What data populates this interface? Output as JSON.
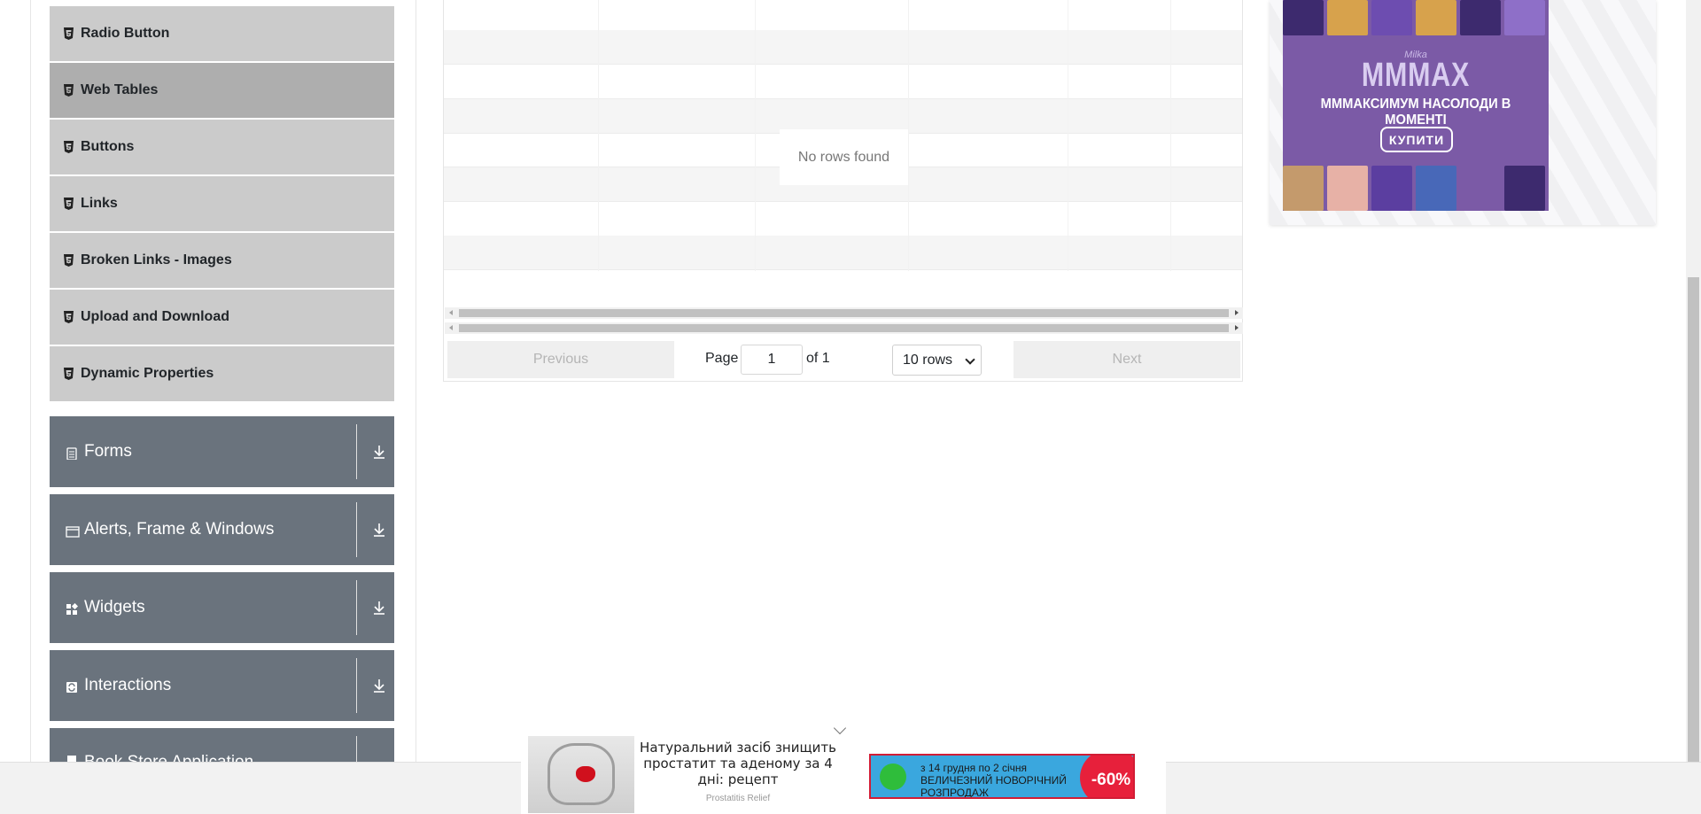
{
  "sidebar": {
    "items": [
      {
        "label": "Radio Button"
      },
      {
        "label": "Web Tables",
        "active": true
      },
      {
        "label": "Buttons"
      },
      {
        "label": "Links"
      },
      {
        "label": "Broken Links - Images"
      },
      {
        "label": "Upload and Download"
      },
      {
        "label": "Dynamic Properties"
      }
    ],
    "groups": [
      {
        "label": "Forms",
        "icon": "clipboard-icon"
      },
      {
        "label": "Alerts, Frame & Windows",
        "icon": "window-icon"
      },
      {
        "label": "Widgets",
        "icon": "widgets-icon"
      },
      {
        "label": "Interactions",
        "icon": "interactions-icon"
      },
      {
        "label": "Book Store Application",
        "icon": "book-icon"
      }
    ]
  },
  "table": {
    "empty_message": "No rows found"
  },
  "pagination": {
    "previous_label": "Previous",
    "page_label": "Page",
    "page_value": "1",
    "of_label": "of 1",
    "rows_selected": "10 rows",
    "next_label": "Next"
  },
  "ad_right": {
    "brand": "Milka",
    "headline": "МММАХ",
    "tagline": "МММАКСИМУМ НАСОЛОДИ В МОМЕНТІ",
    "button": "КУПИТИ",
    "colors": {
      "background": "#7b5aa6"
    }
  },
  "ad_bottom": {
    "text": "Натуральний засіб знищить простатит та аденому за 4 дні: рецепт",
    "source": "Prostatitis Relief",
    "sale_line1": "з 14 грудня по 2 січня",
    "sale_line2": "ВЕЛИЧЕЗНИЙ НОВОРІЧНИЙ",
    "sale_line3": "РОЗПРОДАЖ",
    "discount": "-60%"
  },
  "colors": {
    "menu_item_bg": "#cbcbcb",
    "menu_item_active_bg": "#aeaeae",
    "group_header_bg": "#6a737d"
  }
}
